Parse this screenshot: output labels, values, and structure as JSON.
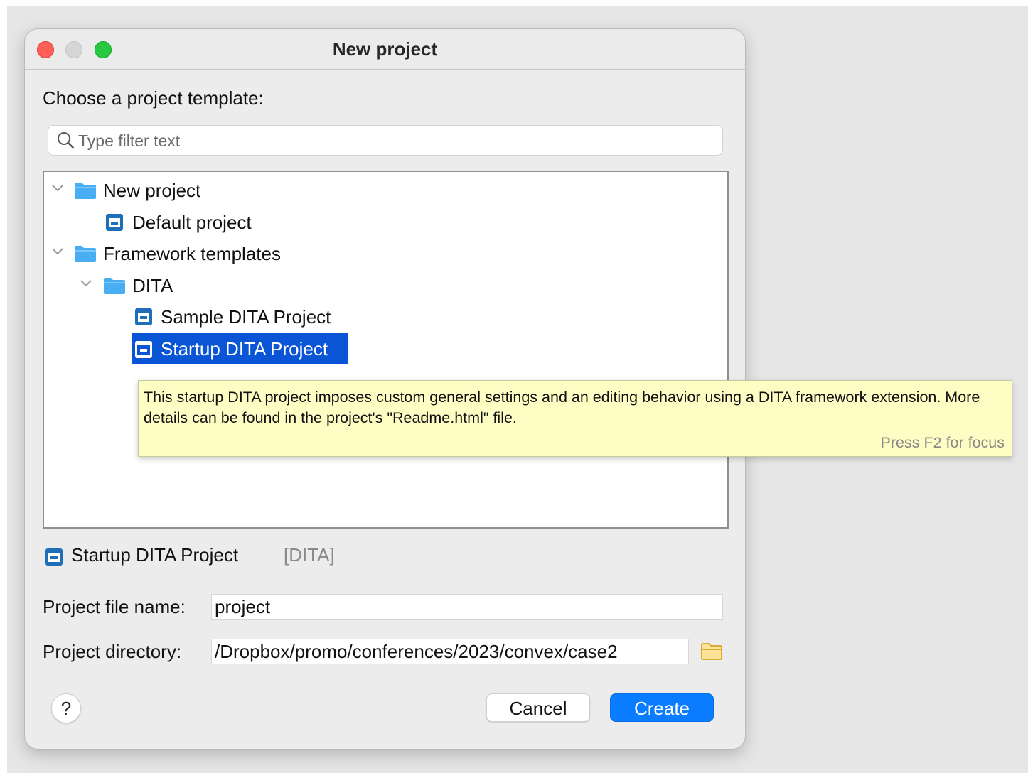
{
  "window": {
    "title": "New project"
  },
  "prompt": "Choose a project template:",
  "filter": {
    "placeholder": "Type filter text",
    "value": ""
  },
  "tree": {
    "nodes": [
      {
        "label": "New project",
        "type": "folder",
        "expanded": true
      },
      {
        "label": "Default project",
        "type": "project"
      },
      {
        "label": "Framework templates",
        "type": "folder",
        "expanded": true
      },
      {
        "label": "DITA",
        "type": "folder",
        "expanded": true
      },
      {
        "label": "Sample DITA Project",
        "type": "project"
      },
      {
        "label": "Startup DITA Project",
        "type": "project",
        "selected": true
      }
    ]
  },
  "tooltip": {
    "text": "This startup DITA project imposes custom general settings and an editing behavior using a DITA framework extension. More details can be found in the project's \"Readme.html\" file.",
    "hint": "Press F2 for focus"
  },
  "selection": {
    "name": "Startup DITA Project",
    "framework": "[DITA]"
  },
  "form": {
    "file_name_label": "Project file name:",
    "file_name_value": "project",
    "directory_label": "Project directory:",
    "directory_value": "/Dropbox/promo/conferences/2023/convex/case2"
  },
  "buttons": {
    "help": "?",
    "cancel": "Cancel",
    "create": "Create"
  },
  "colors": {
    "accent": "#0a7cff",
    "selection": "#0a54d6",
    "tooltip_bg": "#fdfdc4",
    "folder": "#47aef4",
    "project_icon": "#1e6fb8"
  }
}
